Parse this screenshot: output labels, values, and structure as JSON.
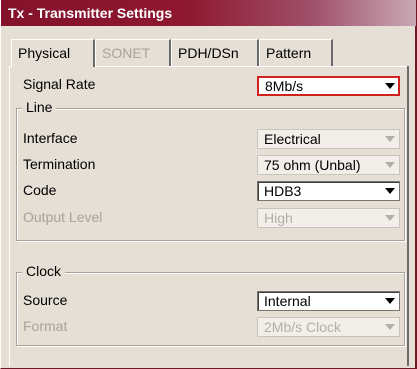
{
  "window": {
    "title": "Tx - Transmitter Settings"
  },
  "tabs": [
    {
      "label": "Physical",
      "active": true,
      "enabled": true
    },
    {
      "label": "SONET",
      "active": false,
      "enabled": false
    },
    {
      "label": "PDH/DSn",
      "active": false,
      "enabled": true
    },
    {
      "label": "Pattern",
      "active": false,
      "enabled": true
    }
  ],
  "signal_rate": {
    "label": "Signal Rate",
    "value": "8Mb/s"
  },
  "line": {
    "title": "Line",
    "interface": {
      "label": "Interface",
      "value": "Electrical",
      "enabled": false
    },
    "termination": {
      "label": "Termination",
      "value": "75 ohm (Unbal)",
      "enabled": false
    },
    "code": {
      "label": "Code",
      "value": "HDB3",
      "enabled": true
    },
    "output_level": {
      "label": "Output Level",
      "value": "High",
      "enabled": false
    }
  },
  "clock": {
    "title": "Clock",
    "source": {
      "label": "Source",
      "value": "Internal",
      "enabled": true
    },
    "format": {
      "label": "Format",
      "value": "2Mb/s Clock",
      "enabled": false
    }
  },
  "colors": {
    "titlebar": "#8e1830",
    "background": "#e6dfd6",
    "focus_border": "#d22020",
    "disabled_text": "#a8a39c"
  }
}
